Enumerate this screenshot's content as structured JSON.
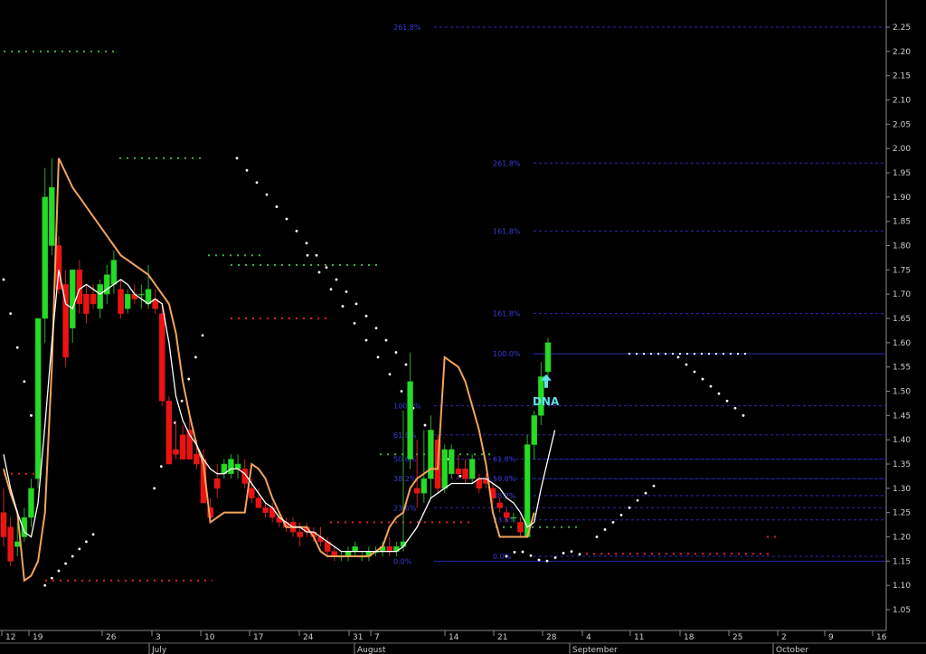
{
  "chart_data": {
    "type": "candlestick",
    "title": "",
    "xlabel": "",
    "ylabel": "",
    "ylim": [
      1.0,
      2.3
    ],
    "y_ticks": [
      "1.05",
      "1.10",
      "1.15",
      "1.20",
      "1.25",
      "1.30",
      "1.35",
      "1.40",
      "1.45",
      "1.50",
      "1.55",
      "1.60",
      "1.65",
      "1.70",
      "1.75",
      "1.80",
      "1.85",
      "1.90",
      "1.95",
      "2.00",
      "2.05",
      "2.10",
      "2.15",
      "2.20",
      "2.25"
    ],
    "x_day_ticks": [
      "12",
      "19",
      "26",
      "3",
      "10",
      "17",
      "24",
      "31",
      "7",
      "14",
      "21",
      "28",
      "4",
      "11",
      "18",
      "25",
      "2",
      "9",
      "16"
    ],
    "months": [
      "July",
      "August",
      "September",
      "October"
    ],
    "colors": {
      "background": "#000000",
      "up_bar": "#22dd22",
      "down_bar": "#ee1111",
      "ma_fast": "#ffffff",
      "ma_slow": "#f2a45a",
      "fib_line": "#2a2ab0",
      "fib_text": "#3b3bd6",
      "support_dots": "#dd2222",
      "resistance_dots": "#33bb33",
      "sar_dots": "#ffffff",
      "annotation": "#5fe0f0"
    },
    "candles": [
      {
        "o": 1.25,
        "h": 1.3,
        "l": 1.18,
        "c": 1.2
      },
      {
        "o": 1.22,
        "h": 1.24,
        "l": 1.14,
        "c": 1.15
      },
      {
        "o": 1.18,
        "h": 1.23,
        "l": 1.16,
        "c": 1.19
      },
      {
        "o": 1.2,
        "h": 1.26,
        "l": 1.19,
        "c": 1.24
      },
      {
        "o": 1.24,
        "h": 1.32,
        "l": 1.22,
        "c": 1.3
      },
      {
        "o": 1.32,
        "h": 1.62,
        "l": 1.3,
        "c": 1.65
      },
      {
        "o": 1.65,
        "h": 1.96,
        "l": 1.6,
        "c": 1.9
      },
      {
        "o": 1.8,
        "h": 1.98,
        "l": 1.78,
        "c": 1.92
      },
      {
        "o": 1.8,
        "h": 1.82,
        "l": 1.7,
        "c": 1.71
      },
      {
        "o": 1.72,
        "h": 1.75,
        "l": 1.55,
        "c": 1.57
      },
      {
        "o": 1.63,
        "h": 1.75,
        "l": 1.6,
        "c": 1.75
      },
      {
        "o": 1.75,
        "h": 1.77,
        "l": 1.66,
        "c": 1.68
      },
      {
        "o": 1.7,
        "h": 1.72,
        "l": 1.64,
        "c": 1.66
      },
      {
        "o": 1.7,
        "h": 1.72,
        "l": 1.67,
        "c": 1.68
      },
      {
        "o": 1.67,
        "h": 1.73,
        "l": 1.65,
        "c": 1.72
      },
      {
        "o": 1.7,
        "h": 1.76,
        "l": 1.68,
        "c": 1.74
      },
      {
        "o": 1.72,
        "h": 1.79,
        "l": 1.7,
        "c": 1.77
      },
      {
        "o": 1.71,
        "h": 1.73,
        "l": 1.65,
        "c": 1.66
      },
      {
        "o": 1.67,
        "h": 1.71,
        "l": 1.66,
        "c": 1.7
      },
      {
        "o": 1.7,
        "h": 1.72,
        "l": 1.68,
        "c": 1.69
      },
      {
        "o": 1.7,
        "h": 1.72,
        "l": 1.67,
        "c": 1.7
      },
      {
        "o": 1.68,
        "h": 1.76,
        "l": 1.67,
        "c": 1.71
      },
      {
        "o": 1.69,
        "h": 1.71,
        "l": 1.66,
        "c": 1.67
      },
      {
        "o": 1.66,
        "h": 1.68,
        "l": 1.47,
        "c": 1.48
      },
      {
        "o": 1.48,
        "h": 1.49,
        "l": 1.35,
        "c": 1.35
      },
      {
        "o": 1.38,
        "h": 1.44,
        "l": 1.36,
        "c": 1.37
      },
      {
        "o": 1.41,
        "h": 1.43,
        "l": 1.36,
        "c": 1.36
      },
      {
        "o": 1.42,
        "h": 1.46,
        "l": 1.36,
        "c": 1.36
      },
      {
        "o": 1.37,
        "h": 1.4,
        "l": 1.34,
        "c": 1.35
      },
      {
        "o": 1.36,
        "h": 1.38,
        "l": 1.27,
        "c": 1.27
      },
      {
        "o": 1.26,
        "h": 1.28,
        "l": 1.23,
        "c": 1.24
      },
      {
        "o": 1.32,
        "h": 1.35,
        "l": 1.28,
        "c": 1.3
      },
      {
        "o": 1.33,
        "h": 1.36,
        "l": 1.32,
        "c": 1.35
      },
      {
        "o": 1.33,
        "h": 1.37,
        "l": 1.32,
        "c": 1.36
      },
      {
        "o": 1.34,
        "h": 1.37,
        "l": 1.32,
        "c": 1.35
      },
      {
        "o": 1.34,
        "h": 1.36,
        "l": 1.3,
        "c": 1.31
      },
      {
        "o": 1.3,
        "h": 1.32,
        "l": 1.27,
        "c": 1.28
      },
      {
        "o": 1.28,
        "h": 1.3,
        "l": 1.26,
        "c": 1.26
      },
      {
        "o": 1.26,
        "h": 1.27,
        "l": 1.24,
        "c": 1.25
      },
      {
        "o": 1.26,
        "h": 1.27,
        "l": 1.23,
        "c": 1.24
      },
      {
        "o": 1.24,
        "h": 1.25,
        "l": 1.22,
        "c": 1.23
      },
      {
        "o": 1.23,
        "h": 1.24,
        "l": 1.21,
        "c": 1.22
      },
      {
        "o": 1.23,
        "h": 1.24,
        "l": 1.2,
        "c": 1.21
      },
      {
        "o": 1.21,
        "h": 1.23,
        "l": 1.18,
        "c": 1.2
      },
      {
        "o": 1.22,
        "h": 1.23,
        "l": 1.2,
        "c": 1.21
      },
      {
        "o": 1.21,
        "h": 1.22,
        "l": 1.19,
        "c": 1.2
      },
      {
        "o": 1.2,
        "h": 1.22,
        "l": 1.18,
        "c": 1.19
      },
      {
        "o": 1.19,
        "h": 1.2,
        "l": 1.16,
        "c": 1.17
      },
      {
        "o": 1.17,
        "h": 1.18,
        "l": 1.15,
        "c": 1.16
      },
      {
        "o": 1.16,
        "h": 1.17,
        "l": 1.15,
        "c": 1.16
      },
      {
        "o": 1.16,
        "h": 1.18,
        "l": 1.15,
        "c": 1.17
      },
      {
        "o": 1.17,
        "h": 1.19,
        "l": 1.16,
        "c": 1.18
      },
      {
        "o": 1.16,
        "h": 1.17,
        "l": 1.15,
        "c": 1.16
      },
      {
        "o": 1.16,
        "h": 1.18,
        "l": 1.15,
        "c": 1.17
      },
      {
        "o": 1.17,
        "h": 1.18,
        "l": 1.16,
        "c": 1.17
      },
      {
        "o": 1.17,
        "h": 1.19,
        "l": 1.16,
        "c": 1.18
      },
      {
        "o": 1.18,
        "h": 1.2,
        "l": 1.16,
        "c": 1.17
      },
      {
        "o": 1.17,
        "h": 1.19,
        "l": 1.16,
        "c": 1.18
      },
      {
        "o": 1.18,
        "h": 1.46,
        "l": 1.17,
        "c": 1.19
      },
      {
        "o": 1.36,
        "h": 1.58,
        "l": 1.34,
        "c": 1.52
      },
      {
        "o": 1.3,
        "h": 1.4,
        "l": 1.26,
        "c": 1.29
      },
      {
        "o": 1.29,
        "h": 1.42,
        "l": 1.27,
        "c": 1.32
      },
      {
        "o": 1.32,
        "h": 1.45,
        "l": 1.28,
        "c": 1.42
      },
      {
        "o": 1.4,
        "h": 1.41,
        "l": 1.29,
        "c": 1.3
      },
      {
        "o": 1.3,
        "h": 1.39,
        "l": 1.29,
        "c": 1.38
      },
      {
        "o": 1.33,
        "h": 1.39,
        "l": 1.32,
        "c": 1.38
      },
      {
        "o": 1.34,
        "h": 1.37,
        "l": 1.32,
        "c": 1.33
      },
      {
        "o": 1.34,
        "h": 1.36,
        "l": 1.31,
        "c": 1.32
      },
      {
        "o": 1.32,
        "h": 1.37,
        "l": 1.31,
        "c": 1.36
      },
      {
        "o": 1.32,
        "h": 1.33,
        "l": 1.29,
        "c": 1.3
      },
      {
        "o": 1.32,
        "h": 1.33,
        "l": 1.3,
        "c": 1.31
      },
      {
        "o": 1.3,
        "h": 1.31,
        "l": 1.27,
        "c": 1.28
      },
      {
        "o": 1.27,
        "h": 1.28,
        "l": 1.25,
        "c": 1.26
      },
      {
        "o": 1.25,
        "h": 1.26,
        "l": 1.23,
        "c": 1.24
      },
      {
        "o": 1.24,
        "h": 1.25,
        "l": 1.23,
        "c": 1.24
      },
      {
        "o": 1.23,
        "h": 1.24,
        "l": 1.2,
        "c": 1.21
      },
      {
        "o": 1.2,
        "h": 1.41,
        "l": 1.2,
        "c": 1.39
      },
      {
        "o": 1.39,
        "h": 1.46,
        "l": 1.36,
        "c": 1.45
      },
      {
        "o": 1.45,
        "h": 1.56,
        "l": 1.43,
        "c": 1.53
      },
      {
        "o": 1.54,
        "h": 1.61,
        "l": 1.53,
        "c": 1.6
      }
    ],
    "series": [
      {
        "values": [
          1.37,
          1.3,
          1.25,
          1.21,
          1.2,
          1.27,
          1.43,
          1.6,
          1.75,
          1.68,
          1.67,
          1.71,
          1.72,
          1.71,
          1.7,
          1.71,
          1.72,
          1.73,
          1.72,
          1.7,
          1.69,
          1.68,
          1.69,
          1.68,
          1.6,
          1.49,
          1.44,
          1.41,
          1.39,
          1.36,
          1.34,
          1.33,
          1.33,
          1.34,
          1.34,
          1.33,
          1.31,
          1.29,
          1.27,
          1.26,
          1.24,
          1.23,
          1.22,
          1.22,
          1.21,
          1.21,
          1.2,
          1.19,
          1.18,
          1.17,
          1.17,
          1.17,
          1.17,
          1.17,
          1.17,
          1.17,
          1.17,
          1.17,
          1.18,
          1.2,
          1.22,
          1.25,
          1.28,
          1.29,
          1.3,
          1.31,
          1.31,
          1.31,
          1.31,
          1.32,
          1.32,
          1.31,
          1.3,
          1.28,
          1.27,
          1.25,
          1.22,
          1.23,
          1.3,
          1.36,
          1.42
        ]
      },
      {
        "values": [
          1.34,
          1.29,
          1.25,
          1.11,
          1.12,
          1.15,
          1.25,
          1.55,
          1.98,
          1.95,
          1.92,
          1.9,
          1.88,
          1.86,
          1.84,
          1.82,
          1.8,
          1.78,
          1.77,
          1.76,
          1.75,
          1.74,
          1.72,
          1.7,
          1.68,
          1.62,
          1.52,
          1.45,
          1.39,
          1.35,
          1.23,
          1.24,
          1.25,
          1.25,
          1.25,
          1.25,
          1.35,
          1.34,
          1.32,
          1.28,
          1.25,
          1.22,
          1.22,
          1.22,
          1.22,
          1.2,
          1.17,
          1.16,
          1.16,
          1.16,
          1.16,
          1.16,
          1.16,
          1.16,
          1.17,
          1.18,
          1.22,
          1.24,
          1.25,
          1.3,
          1.32,
          1.33,
          1.34,
          1.34,
          1.57,
          1.56,
          1.55,
          1.52,
          1.47,
          1.42,
          1.35,
          1.25,
          1.2,
          1.2,
          1.2,
          1.2,
          1.2,
          1.25
        ]
      }
    ],
    "fibonacci_levels": [
      {
        "label": "261.8%",
        "value": 2.25
      },
      {
        "label": "261.8%",
        "value": 1.97
      },
      {
        "label": "161.8%",
        "value": 1.83
      },
      {
        "label": "161.8%",
        "value": 1.66
      },
      {
        "label": "100.0%",
        "value": 1.577
      },
      {
        "label": "100.0%",
        "value": 1.47
      },
      {
        "label": "61.8%",
        "value": 1.41
      },
      {
        "label": "61.8%",
        "value": 1.36
      },
      {
        "label": "50.0%",
        "value": 1.36
      },
      {
        "label": "50.0%",
        "value": 1.32
      },
      {
        "label": "38.2%",
        "value": 1.32
      },
      {
        "label": "38.2%",
        "value": 1.285
      },
      {
        "label": "23.6%",
        "value": 1.26
      },
      {
        "label": "23.6%",
        "value": 1.235
      },
      {
        "label": "0.0%",
        "value": 1.15
      },
      {
        "label": "0.0%",
        "value": 1.16
      }
    ],
    "annotation": {
      "text": "DNA",
      "arrow": "up"
    }
  }
}
